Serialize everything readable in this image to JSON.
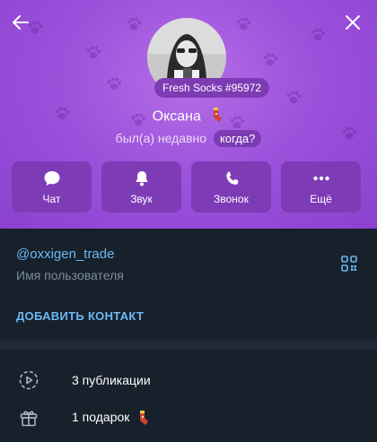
{
  "header": {
    "gift_tag": "Fresh Socks #95972",
    "name": "Оксана",
    "status": "был(а) недавно",
    "when_label": "когда?"
  },
  "actions": [
    {
      "label": "Чат",
      "icon": "chat-bubble-icon"
    },
    {
      "label": "Звук",
      "icon": "bell-icon"
    },
    {
      "label": "Звонок",
      "icon": "phone-icon"
    },
    {
      "label": "Ещё",
      "icon": "more-dots-icon"
    }
  ],
  "info": {
    "username": "@oxxigen_trade",
    "username_caption": "Имя пользователя",
    "add_contact": "ДОБАВИТЬ КОНТАКТ"
  },
  "list": {
    "posts": "3 публикации",
    "gifts": "1 подарок"
  },
  "colors": {
    "header_purple": "#9d52dc",
    "link_blue": "#6eb8f4",
    "background": "#17212b"
  }
}
